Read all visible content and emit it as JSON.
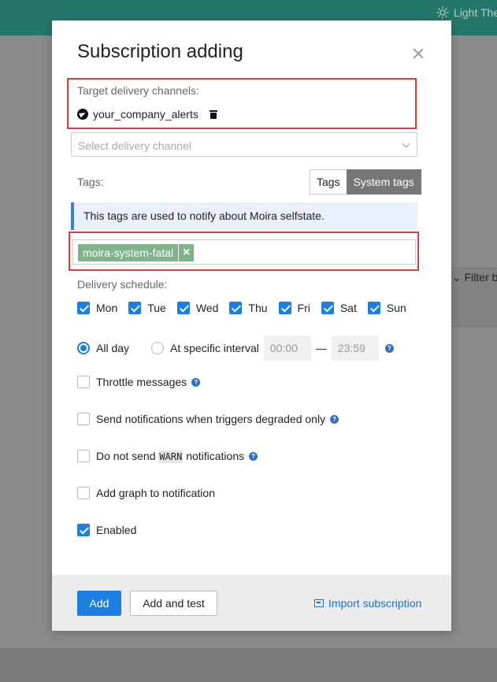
{
  "background": {
    "theme_toggle_label": "Light The",
    "filter_label": "Filter b"
  },
  "modal": {
    "title": "Subscription adding",
    "delivery_channels": {
      "label": "Target delivery channels:",
      "channels": [
        {
          "name": "your_company_alerts",
          "icon": "telegram-icon"
        }
      ],
      "select_placeholder": "Select delivery channel"
    },
    "tags": {
      "label": "Tags:",
      "switch": [
        "Tags",
        "System tags"
      ],
      "active_switch": "System tags",
      "info": "This tags are used to notify about Moira selfstate.",
      "selected": [
        "moira-system-fatal"
      ]
    },
    "schedule": {
      "label": "Delivery schedule:",
      "days": [
        {
          "label": "Mon",
          "checked": true
        },
        {
          "label": "Tue",
          "checked": true
        },
        {
          "label": "Wed",
          "checked": true
        },
        {
          "label": "Thu",
          "checked": true
        },
        {
          "label": "Fri",
          "checked": true
        },
        {
          "label": "Sat",
          "checked": true
        },
        {
          "label": "Sun",
          "checked": true
        }
      ],
      "all_day_label": "All day",
      "interval_label": "At specific interval",
      "from": "00:00",
      "dash": "—",
      "to": "23:59",
      "mode": "all_day"
    },
    "options": {
      "throttle": "Throttle messages",
      "degraded": "Send notifications when triggers degraded only",
      "no_warn_prefix": "Do not send",
      "no_warn_code": "WARN",
      "no_warn_suffix": "notifications",
      "graph": "Add graph to notification",
      "enabled": "Enabled",
      "enabled_checked": true
    },
    "footer": {
      "add": "Add",
      "add_and_test": "Add and test",
      "import": "Import subscription"
    }
  },
  "colors": {
    "header": "#23786a",
    "primary": "#1b7ee0",
    "tag_chip": "#7fb38a",
    "highlight": "#e23b3b"
  }
}
